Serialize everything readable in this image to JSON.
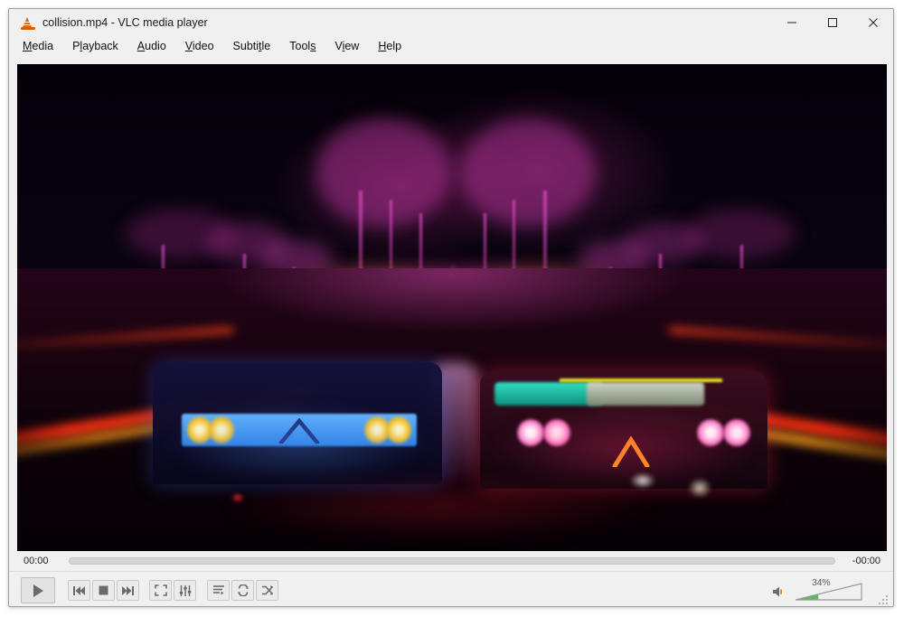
{
  "window": {
    "title": "collision.mp4 - VLC media player",
    "app_icon": "vlc-cone-icon",
    "controls": {
      "minimize": "minimize-icon",
      "maximize": "maximize-icon",
      "close": "close-icon"
    }
  },
  "menubar": {
    "items": [
      {
        "label": "Media",
        "pre": "",
        "key": "M",
        "post": "edia"
      },
      {
        "label": "Playback",
        "pre": "P",
        "key": "l",
        "post": "ayback"
      },
      {
        "label": "Audio",
        "pre": "",
        "key": "A",
        "post": "udio"
      },
      {
        "label": "Video",
        "pre": "",
        "key": "V",
        "post": "ideo"
      },
      {
        "label": "Subtitle",
        "pre": "Subti",
        "key": "t",
        "post": "le"
      },
      {
        "label": "Tools",
        "pre": "Tool",
        "key": "s",
        "post": ""
      },
      {
        "label": "View",
        "pre": "V",
        "key": "i",
        "post": "ew"
      },
      {
        "label": "Help",
        "pre": "",
        "key": "H",
        "post": "elp"
      }
    ]
  },
  "video": {
    "description": "Night street racing scene: two cars rear view facing a neon magenta horizon, palm trees silhouetted in pink, blue hills, wet asphalt with red light streaks",
    "colors": {
      "sky": "#050008",
      "palm_glow": "#d246b9",
      "hill_blue": "#2a22c8",
      "horizon_magenta": "#ff2fb4",
      "horizon_yellow": "#ffc21e",
      "road_red_streak": "#ff2a12",
      "left_car_panel": "#3fa0ff",
      "left_car_lamp": "#ffc21a",
      "right_car_lamp": "#ff7ad0",
      "right_car_roof": "#13c6a8",
      "right_car_chevron": "#ff9a16"
    }
  },
  "playback": {
    "elapsed": "00:00",
    "remaining": "-00:00",
    "progress_percent": 0
  },
  "controls": {
    "play": {
      "name": "play-button",
      "title": "Play"
    },
    "previous": {
      "name": "previous-button",
      "title": "Previous"
    },
    "stop": {
      "name": "stop-button",
      "title": "Stop"
    },
    "next": {
      "name": "next-button",
      "title": "Next"
    },
    "fullscreen": {
      "name": "fullscreen-button",
      "title": "Toggle fullscreen"
    },
    "extended": {
      "name": "extended-settings-button",
      "title": "Show extended settings"
    },
    "playlist": {
      "name": "playlist-button",
      "title": "Show playlist"
    },
    "loop": {
      "name": "loop-button",
      "title": "Loop"
    },
    "random": {
      "name": "random-button",
      "title": "Random"
    }
  },
  "volume": {
    "label": "34%",
    "percent": 34,
    "icon": "speaker-icon",
    "fill_color": "#5cb85c"
  }
}
